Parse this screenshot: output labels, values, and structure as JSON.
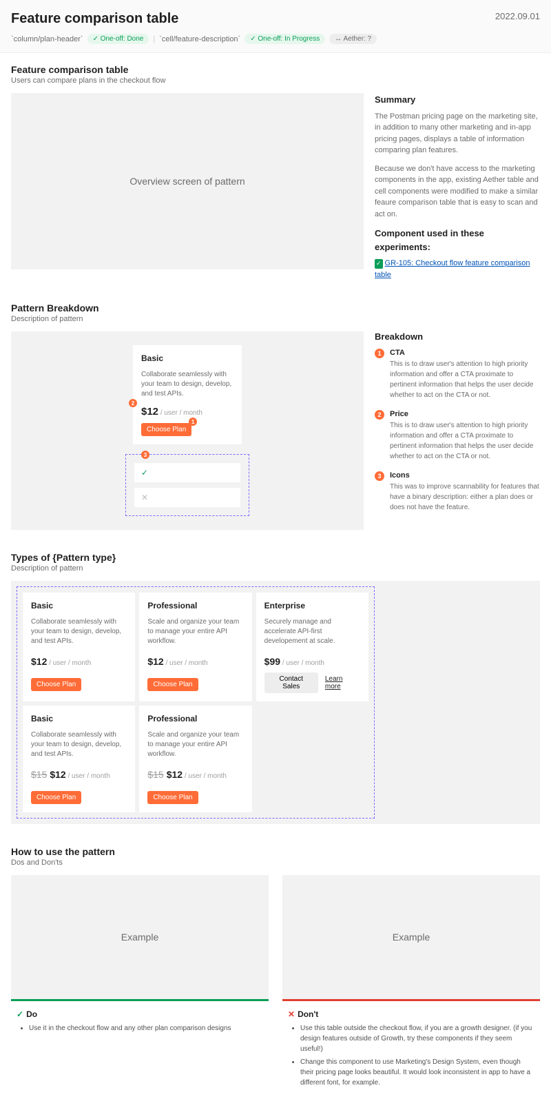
{
  "header": {
    "title": "Feature comparison table",
    "date": "2022.09.01",
    "tags": [
      {
        "code": "`column/plan-header`",
        "pill": "✓ One-off: Done",
        "cls": "pill-done"
      },
      {
        "code": "`cell/feature-description`",
        "pill": "✓ One-off: In Progress",
        "cls": "pill-progress"
      },
      {
        "code": "",
        "pill": "↔ Aether: ?",
        "cls": "pill-unk"
      }
    ]
  },
  "intro": {
    "heading": "Feature comparison table",
    "sub": "Users can compare plans in the checkout flow",
    "overview_placeholder": "Overview screen of pattern",
    "summary_h": "Summary",
    "summary_p1": "The Postman pricing page on the marketing site, in addition to many other marketing and in-app pricing pages, displays a table of information comparing plan features.",
    "summary_p2": "Because we don't have access to the marketing components in the app, existing Aether table and cell components were modified to make a similar feaure comparison table that is easy to scan and act on.",
    "experiments_h": "Component used in these experiments:",
    "exp_link": "GR-105: Checkout flow feature comparison table"
  },
  "breakdown": {
    "heading": "Pattern Breakdown",
    "sub": "Description of pattern",
    "plan": {
      "name": "Basic",
      "desc": "Collaborate seamlessly with your team to design, develop, and test APIs.",
      "price": "$12",
      "unit": " / user / month",
      "btn": "Choose Plan"
    },
    "right_h": "Breakdown",
    "items": [
      {
        "t": "CTA",
        "d": "This is to draw user's attention to high priority information and offer a CTA proximate to pertinent information that helps the user decide whether to act on the CTA or not."
      },
      {
        "t": "Price",
        "d": "This is to draw user's attention to high priority information and offer a CTA proximate to pertinent information that helps the user decide whether to act on the CTA or not."
      },
      {
        "t": "Icons",
        "d": "This was to improve scannability for features that have a binary description: either a plan does or does not have the feature."
      }
    ]
  },
  "types": {
    "heading": "Types of {Pattern type}",
    "sub": "Description of pattern",
    "row1": [
      {
        "name": "Basic",
        "desc": "Collaborate seamlessly with your team to design, develop, and test APIs.",
        "price": "$12",
        "unit": " / user / month",
        "btn": "Choose Plan"
      },
      {
        "name": "Professional",
        "desc": "Scale and organize your team to manage your entire API workflow.",
        "price": "$12",
        "unit": " / user / month",
        "btn": "Choose Plan"
      },
      {
        "name": "Enterprise",
        "desc": "Securely manage and accelerate API-first developement at scale.",
        "price": "$99",
        "unit": " / user / month",
        "contact": "Contact Sales",
        "learn": "Learn more"
      }
    ],
    "row2": [
      {
        "name": "Basic",
        "desc": "Collaborate seamlessly with your team to design, develop, and test APIs.",
        "old": "$15",
        "price": "$12",
        "unit": " / user / month",
        "btn": "Choose Plan"
      },
      {
        "name": "Professional",
        "desc": "Scale and organize your team to manage your entire API workflow.",
        "old": "$15",
        "price": "$12",
        "unit": " / user / month",
        "btn": "Choose Plan"
      }
    ]
  },
  "howto": {
    "heading": "How to use the pattern",
    "sub": "Dos and Don'ts",
    "example": "Example",
    "do_h": "Do",
    "do_items": [
      "Use it in the checkout flow and any other plan comparison designs"
    ],
    "dont_h": "Don't",
    "dont_items": [
      "Use this table outside the checkout flow, if you are a growth designer. (if you design features outside of Growth, try these components if they seem useful!)",
      "Change this component to use Marketing's Design System, even though their pricing page looks beautiful. It would look inconsistent in app to have a different font, for example."
    ]
  }
}
